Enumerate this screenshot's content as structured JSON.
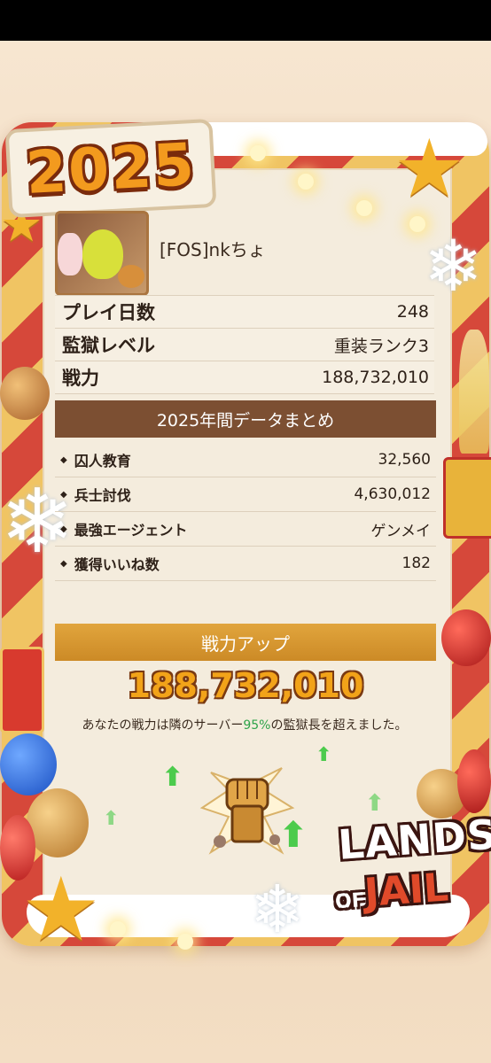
{
  "year_badge": "2025",
  "profile": {
    "player_name": "[FOS]nkちょ"
  },
  "stats": [
    {
      "label": "プレイ日数",
      "value": "248"
    },
    {
      "label": "監獄レベル",
      "value": "重装ランク3"
    },
    {
      "label": "戦力",
      "value": "188,732,010"
    }
  ],
  "summary": {
    "title": "2025年間データまとめ",
    "rows": [
      {
        "label": "囚人教育",
        "value": "32,560"
      },
      {
        "label": "兵士討伐",
        "value": "4,630,012"
      },
      {
        "label": "最強エージェント",
        "value": "ゲンメイ"
      },
      {
        "label": "獲得いいね数",
        "value": "182"
      }
    ]
  },
  "power_up": {
    "title": "戦力アップ",
    "value": "188,732,010",
    "message_before": "あなたの戦力は隣のサーバー",
    "percent": "95%",
    "message_after": "の監獄長を超えました。"
  },
  "logo": {
    "line1": "LANDS",
    "of": "OF",
    "line2": "JAIL"
  },
  "colors": {
    "header_brown": "#7c4f32",
    "power_orange": "#e1a53d",
    "percent_green": "#2ea44a"
  }
}
